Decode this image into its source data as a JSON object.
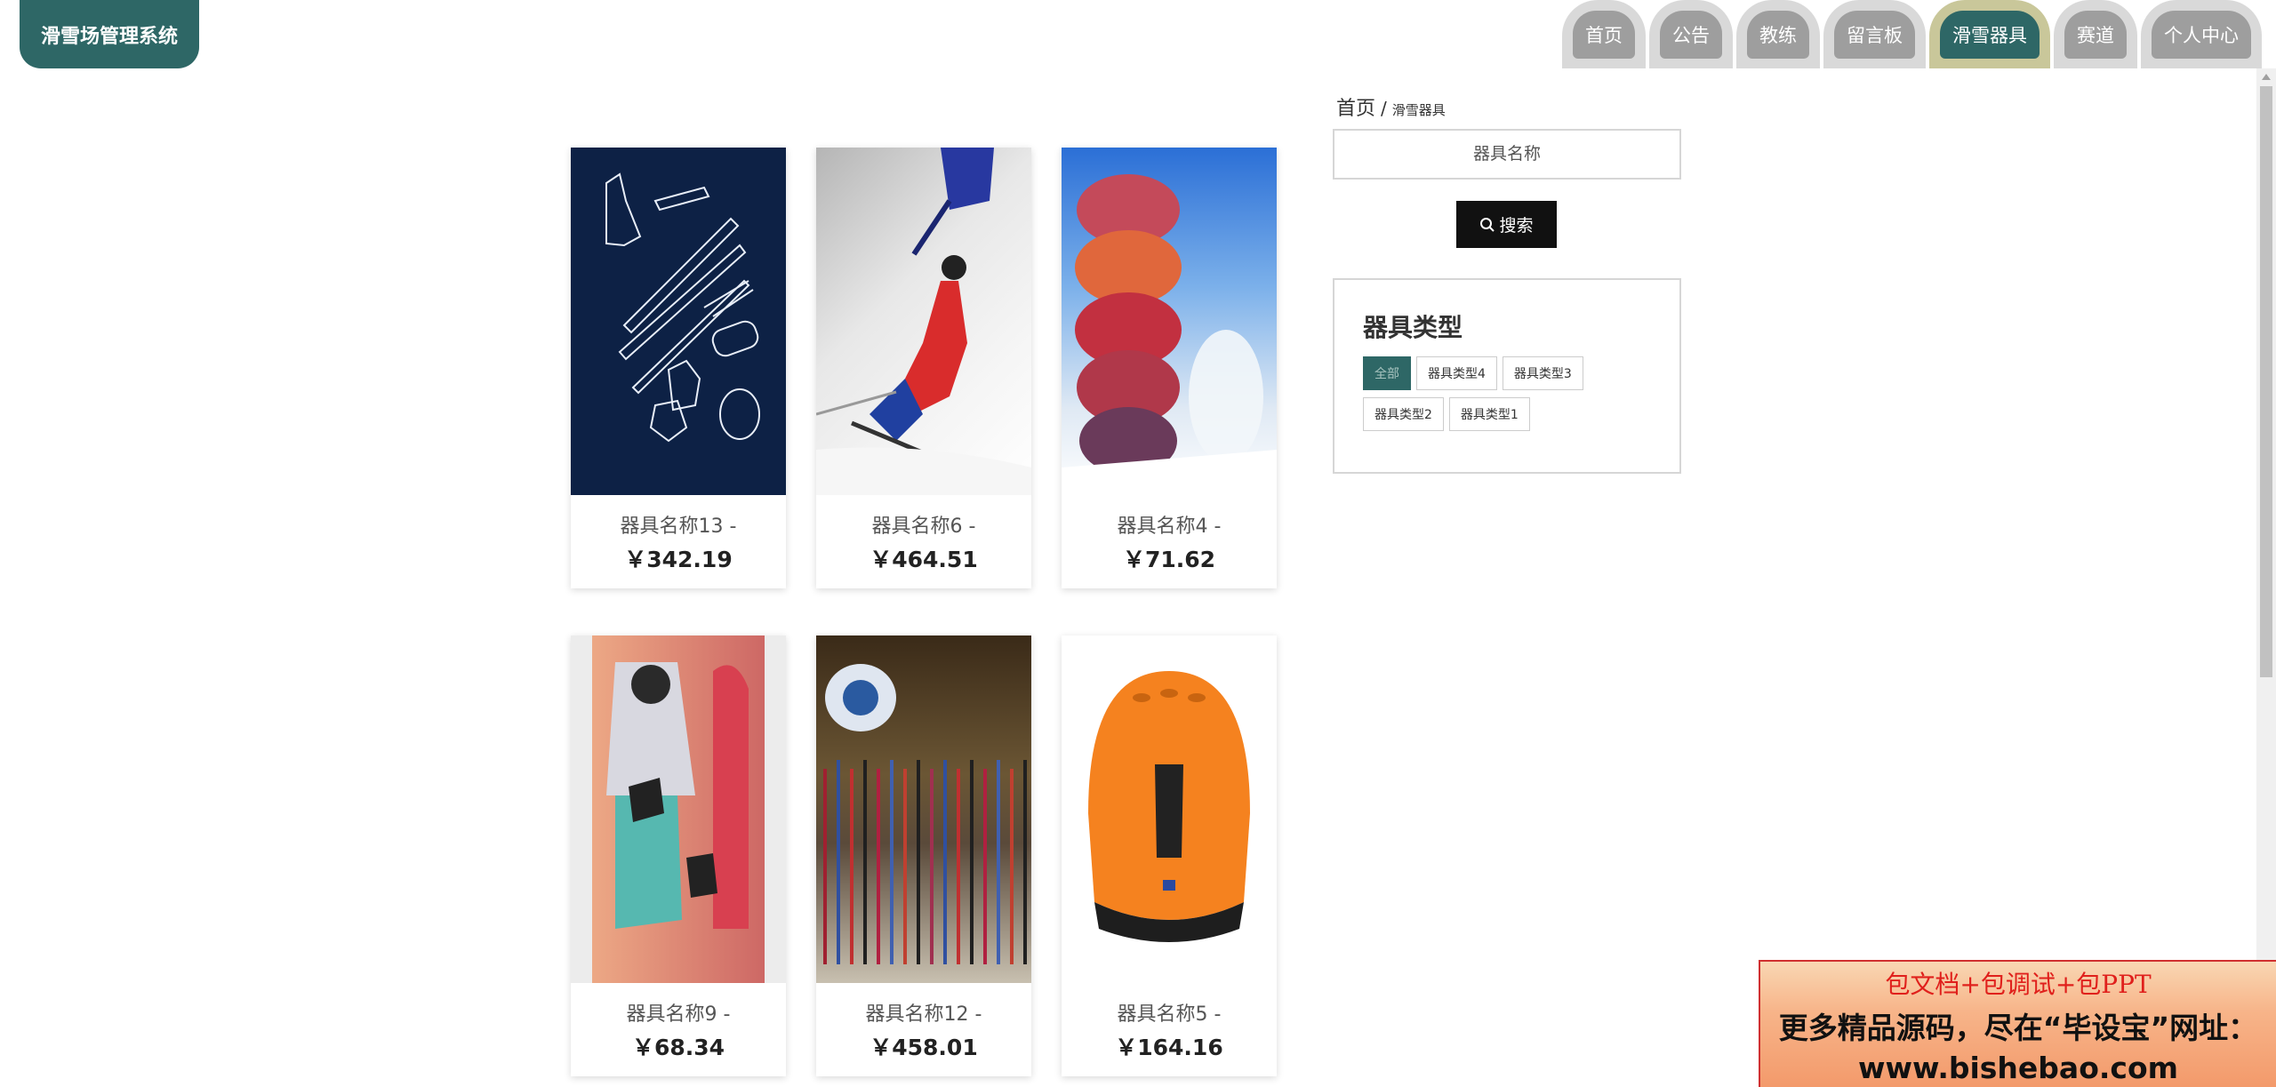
{
  "app": {
    "logo": "滑雪场管理系统"
  },
  "nav": {
    "items": [
      {
        "label": "首页",
        "active": false
      },
      {
        "label": "公告",
        "active": false
      },
      {
        "label": "教练",
        "active": false
      },
      {
        "label": "留言板",
        "active": false
      },
      {
        "label": "滑雪器具",
        "active": true
      },
      {
        "label": "赛道",
        "active": false
      },
      {
        "label": "个人中心",
        "active": false
      }
    ]
  },
  "breadcrumb": {
    "home": "首页",
    "separator": "/",
    "current": "滑雪器具"
  },
  "search": {
    "placeholder": "器具名称",
    "button_label": "搜索",
    "button_icon": "search-icon"
  },
  "types": {
    "title": "器具类型",
    "tags": [
      {
        "label": "全部",
        "active": true
      },
      {
        "label": "器具类型4",
        "active": false
      },
      {
        "label": "器具类型3",
        "active": false
      },
      {
        "label": "器具类型2",
        "active": false
      },
      {
        "label": "器具类型1",
        "active": false
      }
    ]
  },
  "products": [
    {
      "name": "器具名称13 -",
      "price": "￥342.19"
    },
    {
      "name": "器具名称6 -",
      "price": "￥464.51"
    },
    {
      "name": "器具名称4 -",
      "price": "￥71.62"
    },
    {
      "name": "器具名称9 -",
      "price": "￥68.34"
    },
    {
      "name": "器具名称12 -",
      "price": "￥458.01"
    },
    {
      "name": "器具名称5 -",
      "price": "￥164.16"
    }
  ],
  "ad": {
    "line1": "包文档+包调试+包PPT",
    "line2": "更多精品源码，尽在“毕设宝”网址：",
    "line3": "www.bishebao.com"
  },
  "colors": {
    "primary": "#2e6766",
    "nav_inactive": "#9e9e9e",
    "nav_active_ring": "#c9c79a"
  }
}
